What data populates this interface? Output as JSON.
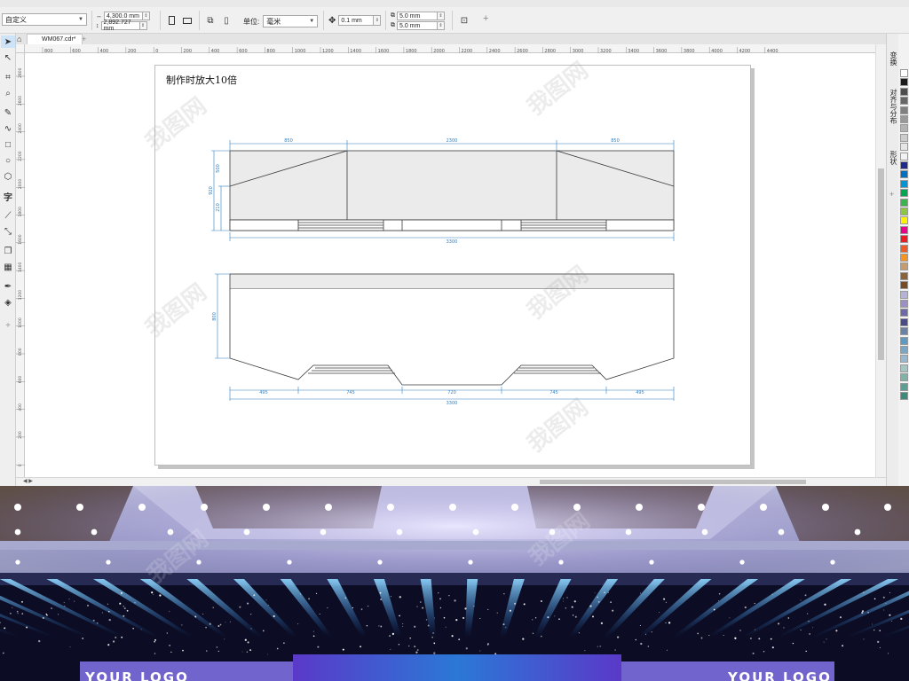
{
  "propertybar": {
    "preset": "自定义",
    "width": "4,300.0 mm",
    "height": "2,892.727 mm",
    "units_label": "单位:",
    "units": "毫米",
    "nudge": "0.1 mm",
    "dup_x": "5.0 mm",
    "dup_y": "5.0 mm"
  },
  "document": {
    "tab_title": "WM067.cdr*"
  },
  "ruler": {
    "h_ticks": [
      "800",
      "600",
      "400",
      "200",
      "0",
      "200",
      "400",
      "600",
      "800",
      "1000",
      "1200",
      "1400",
      "1600",
      "1800",
      "2000",
      "2200",
      "2400",
      "2600",
      "2800",
      "3000",
      "3200",
      "3400",
      "3600",
      "3800",
      "4000",
      "4200",
      "4400"
    ],
    "v_ticks": [
      "2800",
      "2600",
      "2400",
      "2200",
      "2000",
      "1800",
      "1600",
      "1400",
      "1200",
      "1000",
      "800",
      "600",
      "400",
      "200",
      "0"
    ]
  },
  "page": {
    "note": "制作时放大10倍",
    "front_dims": {
      "left": "850",
      "center": "2300",
      "right": "850",
      "total": "3300",
      "h_total": "920",
      "h_a": "500",
      "h_b": "210"
    },
    "plan_dims": {
      "d1": "495",
      "d2": "745",
      "d3": "720",
      "d4": "745",
      "d5": "495",
      "total": "3300",
      "depth": "800"
    }
  },
  "docker": {
    "tabs": [
      "变换",
      "对齐与分布",
      "形状"
    ]
  },
  "palette": {
    "colors": [
      "#ffffff",
      "#1a1a1a",
      "#4d4d4d",
      "#666666",
      "#808080",
      "#999999",
      "#b3b3b3",
      "#cccccc",
      "#e6e6e6",
      "#f2f2f2",
      "#1f2a8c",
      "#0070c0",
      "#0096d6",
      "#00a651",
      "#39b54a",
      "#8dc63f",
      "#fff200",
      "#ec008c",
      "#ed1c24",
      "#f15a24",
      "#f7941d",
      "#c69c6d",
      "#8c6239",
      "#754c24",
      "#b5b1d8",
      "#9b8fc6",
      "#6d6aa8",
      "#4a4a8a",
      "#6a82a8",
      "#5d9bc4",
      "#79a7c7",
      "#96b9d1",
      "#a3c5c3",
      "#7fb3a8",
      "#5aa093",
      "#3c8a7a"
    ]
  },
  "scene": {
    "logo_left": "YOUR LOGO",
    "logo_right": "YOUR LOGO"
  },
  "watermark": "我图网"
}
